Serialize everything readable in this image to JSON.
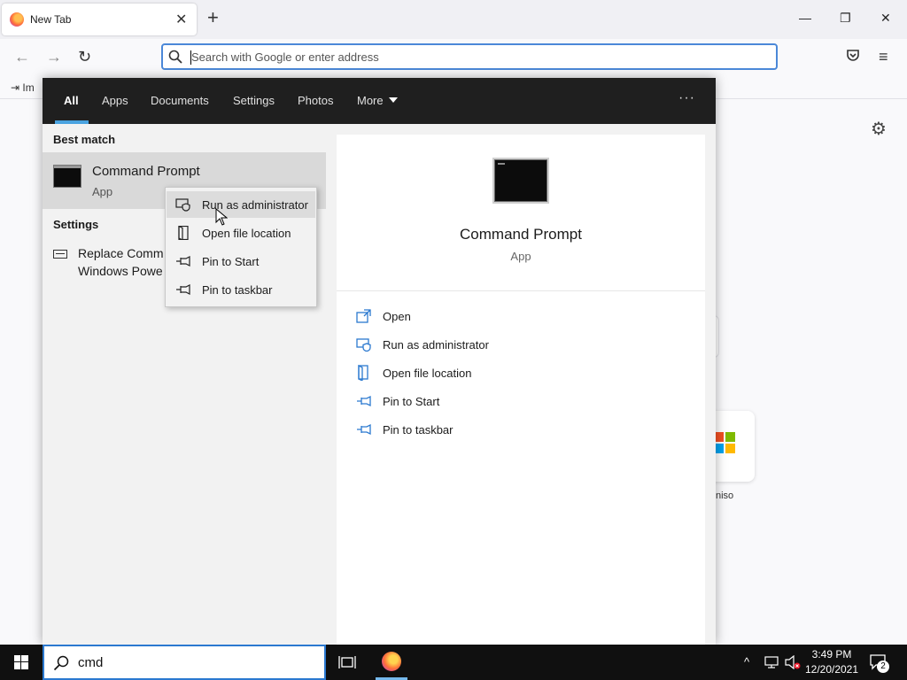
{
  "browser": {
    "tab_title": "New Tab",
    "tab_close": "✕",
    "new_tab": "+",
    "window_min": "—",
    "window_restore": "❐",
    "window_close": "✕",
    "url_placeholder": "Search with Google or enter address",
    "bookmark_label": "Im",
    "tile_label": "niso"
  },
  "search_panel": {
    "tabs": [
      {
        "label": "All"
      },
      {
        "label": "Apps"
      },
      {
        "label": "Documents"
      },
      {
        "label": "Settings"
      },
      {
        "label": "Photos"
      },
      {
        "label": "More"
      }
    ],
    "options_icon": "···",
    "best_match_heading": "Best match",
    "best_match": {
      "name": "Command Prompt",
      "type": "App"
    },
    "settings_heading": "Settings",
    "setting_result_line1": "Replace Comm",
    "setting_result_line2": "Windows Powe",
    "preview": {
      "name": "Command Prompt",
      "type": "App"
    },
    "actions": [
      {
        "label": "Open"
      },
      {
        "label": "Run as administrator"
      },
      {
        "label": "Open file location"
      },
      {
        "label": "Pin to Start"
      },
      {
        "label": "Pin to taskbar"
      }
    ]
  },
  "context_menu": {
    "items": [
      {
        "label": "Run as administrator"
      },
      {
        "label": "Open file location"
      },
      {
        "label": "Pin to Start"
      },
      {
        "label": "Pin to taskbar"
      }
    ]
  },
  "taskbar": {
    "search_value": "cmd",
    "time": "3:49 PM",
    "date": "12/20/2021",
    "notification_count": "2"
  },
  "colors": {
    "accent_blue": "#4aa3e0",
    "panel_dark": "#1f1f1f",
    "taskbar": "#101010"
  }
}
